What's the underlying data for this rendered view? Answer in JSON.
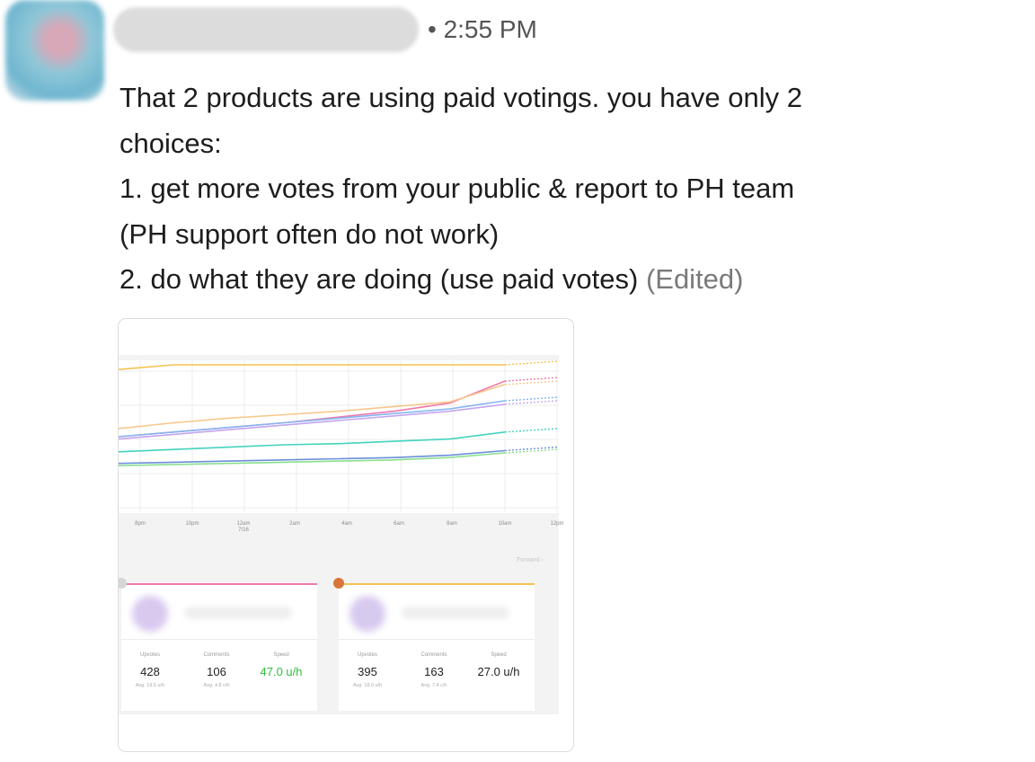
{
  "header": {
    "time": "• 2:55 PM"
  },
  "message": {
    "lines": [
      "That 2 products are using paid votings. you have only 2",
      "choices:",
      "1. get more votes from your public & report to PH team",
      "(PH support often do not work)",
      "2. do what they are doing (use paid votes)"
    ],
    "edited_label": "(Edited)"
  },
  "attachment": {
    "x_ticks": [
      "8pm",
      "10pm",
      "12am",
      "2am",
      "4am",
      "6am",
      "8am",
      "10am",
      "12pm"
    ],
    "x_subtick": "7/16",
    "forward_label": "Forward ›",
    "products": [
      {
        "accent": "#f07aaa",
        "upvotes_label": "Upvotes",
        "upvotes": "428",
        "upvotes_avg": "Avg. 19.5 u/h",
        "comments_label": "Comments",
        "comments": "106",
        "comments_avg": "Avg. 4.8 c/h",
        "speed_label": "Speed",
        "speed": "47.0 u/h"
      },
      {
        "accent": "#f5c251",
        "upvotes_label": "Upvotes",
        "upvotes": "395",
        "upvotes_avg": "Avg. 18.0 u/h",
        "comments_label": "Comments",
        "comments": "163",
        "comments_avg": "Avg. 7.4 c/h",
        "speed_label": "Speed",
        "speed": "27.0 u/h"
      }
    ]
  },
  "chart_data": {
    "type": "line",
    "x": [
      "8pm",
      "10pm",
      "12am",
      "2am",
      "4am",
      "6am",
      "8am",
      "10am"
    ],
    "ylim": [
      0,
      100
    ],
    "grid": true,
    "series": [
      {
        "color": "#f5c251",
        "values": [
          96,
          100,
          100,
          100,
          100,
          100,
          100,
          100
        ]
      },
      {
        "color": "#f07aaa",
        "values": [
          38,
          42,
          46,
          50,
          55,
          60,
          67,
          86
        ]
      },
      {
        "color": "#f8c88a",
        "values": [
          45,
          50,
          54,
          57,
          60,
          64,
          68,
          83
        ]
      },
      {
        "color": "#84b5f2",
        "values": [
          38,
          42,
          46,
          50,
          54,
          58,
          62,
          69
        ]
      },
      {
        "color": "#c3a5ef",
        "values": [
          36,
          40,
          44,
          48,
          52,
          56,
          60,
          66
        ]
      },
      {
        "color": "#43d3be",
        "values": [
          25,
          27,
          29,
          31,
          32,
          34,
          36,
          42
        ]
      },
      {
        "color": "#6b8fd8",
        "values": [
          15,
          16,
          17,
          18,
          19,
          20,
          22,
          26
        ]
      },
      {
        "color": "#8be08f",
        "values": [
          13,
          14,
          15,
          16,
          17,
          18,
          20,
          24
        ]
      }
    ]
  }
}
